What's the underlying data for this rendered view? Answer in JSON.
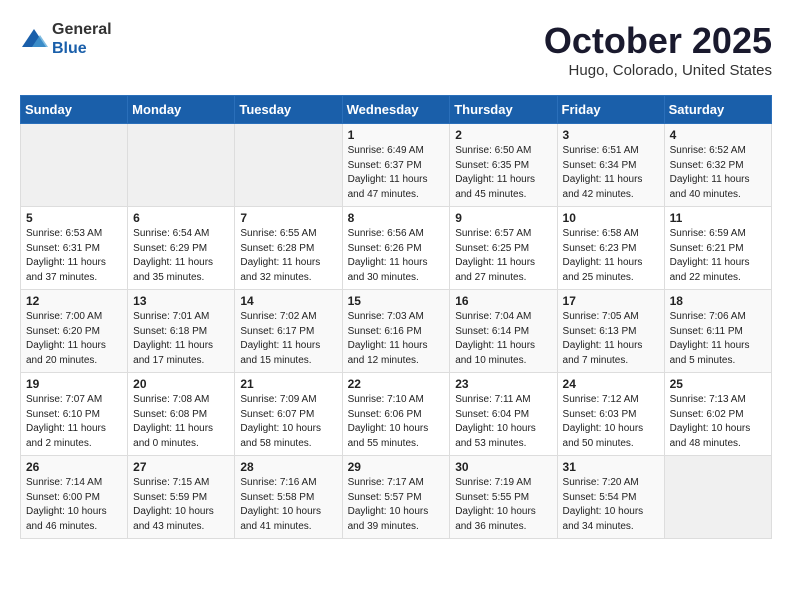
{
  "logo": {
    "general": "General",
    "blue": "Blue"
  },
  "header": {
    "month": "October 2025",
    "location": "Hugo, Colorado, United States"
  },
  "weekdays": [
    "Sunday",
    "Monday",
    "Tuesday",
    "Wednesday",
    "Thursday",
    "Friday",
    "Saturday"
  ],
  "weeks": [
    [
      {
        "day": "",
        "info": ""
      },
      {
        "day": "",
        "info": ""
      },
      {
        "day": "",
        "info": ""
      },
      {
        "day": "1",
        "info": "Sunrise: 6:49 AM\nSunset: 6:37 PM\nDaylight: 11 hours\nand 47 minutes."
      },
      {
        "day": "2",
        "info": "Sunrise: 6:50 AM\nSunset: 6:35 PM\nDaylight: 11 hours\nand 45 minutes."
      },
      {
        "day": "3",
        "info": "Sunrise: 6:51 AM\nSunset: 6:34 PM\nDaylight: 11 hours\nand 42 minutes."
      },
      {
        "day": "4",
        "info": "Sunrise: 6:52 AM\nSunset: 6:32 PM\nDaylight: 11 hours\nand 40 minutes."
      }
    ],
    [
      {
        "day": "5",
        "info": "Sunrise: 6:53 AM\nSunset: 6:31 PM\nDaylight: 11 hours\nand 37 minutes."
      },
      {
        "day": "6",
        "info": "Sunrise: 6:54 AM\nSunset: 6:29 PM\nDaylight: 11 hours\nand 35 minutes."
      },
      {
        "day": "7",
        "info": "Sunrise: 6:55 AM\nSunset: 6:28 PM\nDaylight: 11 hours\nand 32 minutes."
      },
      {
        "day": "8",
        "info": "Sunrise: 6:56 AM\nSunset: 6:26 PM\nDaylight: 11 hours\nand 30 minutes."
      },
      {
        "day": "9",
        "info": "Sunrise: 6:57 AM\nSunset: 6:25 PM\nDaylight: 11 hours\nand 27 minutes."
      },
      {
        "day": "10",
        "info": "Sunrise: 6:58 AM\nSunset: 6:23 PM\nDaylight: 11 hours\nand 25 minutes."
      },
      {
        "day": "11",
        "info": "Sunrise: 6:59 AM\nSunset: 6:21 PM\nDaylight: 11 hours\nand 22 minutes."
      }
    ],
    [
      {
        "day": "12",
        "info": "Sunrise: 7:00 AM\nSunset: 6:20 PM\nDaylight: 11 hours\nand 20 minutes."
      },
      {
        "day": "13",
        "info": "Sunrise: 7:01 AM\nSunset: 6:18 PM\nDaylight: 11 hours\nand 17 minutes."
      },
      {
        "day": "14",
        "info": "Sunrise: 7:02 AM\nSunset: 6:17 PM\nDaylight: 11 hours\nand 15 minutes."
      },
      {
        "day": "15",
        "info": "Sunrise: 7:03 AM\nSunset: 6:16 PM\nDaylight: 11 hours\nand 12 minutes."
      },
      {
        "day": "16",
        "info": "Sunrise: 7:04 AM\nSunset: 6:14 PM\nDaylight: 11 hours\nand 10 minutes."
      },
      {
        "day": "17",
        "info": "Sunrise: 7:05 AM\nSunset: 6:13 PM\nDaylight: 11 hours\nand 7 minutes."
      },
      {
        "day": "18",
        "info": "Sunrise: 7:06 AM\nSunset: 6:11 PM\nDaylight: 11 hours\nand 5 minutes."
      }
    ],
    [
      {
        "day": "19",
        "info": "Sunrise: 7:07 AM\nSunset: 6:10 PM\nDaylight: 11 hours\nand 2 minutes."
      },
      {
        "day": "20",
        "info": "Sunrise: 7:08 AM\nSunset: 6:08 PM\nDaylight: 11 hours\nand 0 minutes."
      },
      {
        "day": "21",
        "info": "Sunrise: 7:09 AM\nSunset: 6:07 PM\nDaylight: 10 hours\nand 58 minutes."
      },
      {
        "day": "22",
        "info": "Sunrise: 7:10 AM\nSunset: 6:06 PM\nDaylight: 10 hours\nand 55 minutes."
      },
      {
        "day": "23",
        "info": "Sunrise: 7:11 AM\nSunset: 6:04 PM\nDaylight: 10 hours\nand 53 minutes."
      },
      {
        "day": "24",
        "info": "Sunrise: 7:12 AM\nSunset: 6:03 PM\nDaylight: 10 hours\nand 50 minutes."
      },
      {
        "day": "25",
        "info": "Sunrise: 7:13 AM\nSunset: 6:02 PM\nDaylight: 10 hours\nand 48 minutes."
      }
    ],
    [
      {
        "day": "26",
        "info": "Sunrise: 7:14 AM\nSunset: 6:00 PM\nDaylight: 10 hours\nand 46 minutes."
      },
      {
        "day": "27",
        "info": "Sunrise: 7:15 AM\nSunset: 5:59 PM\nDaylight: 10 hours\nand 43 minutes."
      },
      {
        "day": "28",
        "info": "Sunrise: 7:16 AM\nSunset: 5:58 PM\nDaylight: 10 hours\nand 41 minutes."
      },
      {
        "day": "29",
        "info": "Sunrise: 7:17 AM\nSunset: 5:57 PM\nDaylight: 10 hours\nand 39 minutes."
      },
      {
        "day": "30",
        "info": "Sunrise: 7:19 AM\nSunset: 5:55 PM\nDaylight: 10 hours\nand 36 minutes."
      },
      {
        "day": "31",
        "info": "Sunrise: 7:20 AM\nSunset: 5:54 PM\nDaylight: 10 hours\nand 34 minutes."
      },
      {
        "day": "",
        "info": ""
      }
    ]
  ]
}
